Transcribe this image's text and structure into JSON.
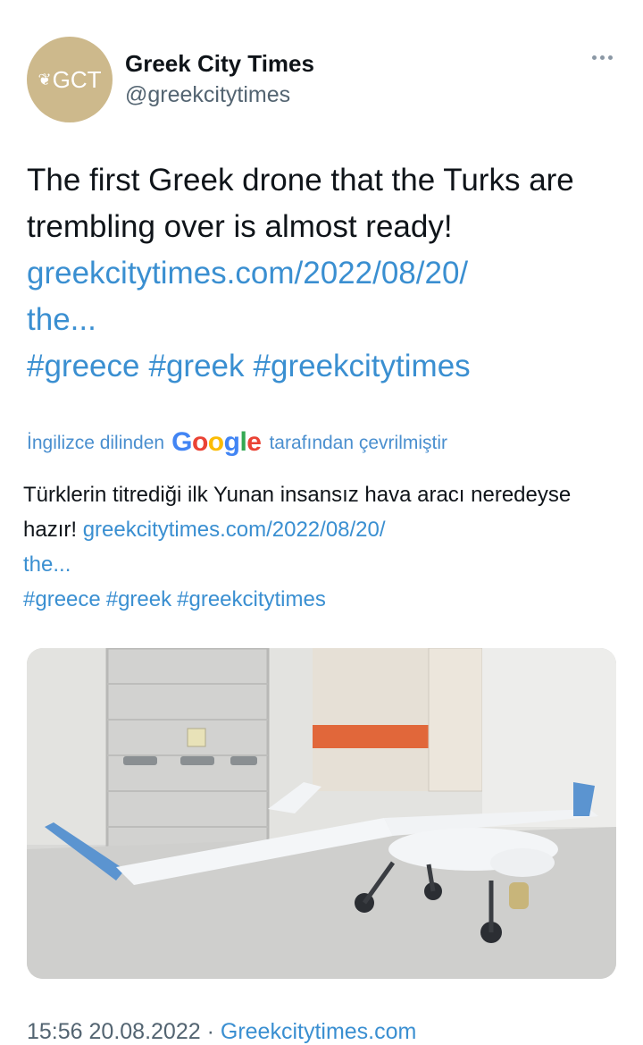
{
  "account": {
    "name": "Greek City Times",
    "handle": "@greekcitytimes",
    "avatar_text": "GCT",
    "avatar_color": "#cdb98c"
  },
  "tweet": {
    "text": "The first Greek drone that the Turks are trembling over is almost ready!",
    "link_line1": "greekcitytimes.com/2022/08/20/",
    "link_line2": "the...",
    "hashtags": [
      "#greece",
      "#greek",
      "#greekcitytimes"
    ]
  },
  "translation": {
    "prefix": "İngilizce dilinden",
    "brand": "Google",
    "suffix": "tarafından çevrilmiştir",
    "text": "Türklerin titrediği ilk Yunan insansız hava aracı neredeyse hazır!",
    "link_line1": "greekcitytimes.com/2022/08/20/",
    "link_line2": "the...",
    "hashtags": [
      "#greece",
      "#greek",
      "#greekcitytimes"
    ]
  },
  "footer": {
    "time": "15:56",
    "date": "20.08.2022",
    "separator": "·",
    "source": "Greekcitytimes.com"
  },
  "colors": {
    "link": "#3a8fd1",
    "secondary_text": "#536471",
    "avatar": "#cdb98c"
  },
  "icons": [
    "more-options-icon",
    "leaf-icon"
  ]
}
